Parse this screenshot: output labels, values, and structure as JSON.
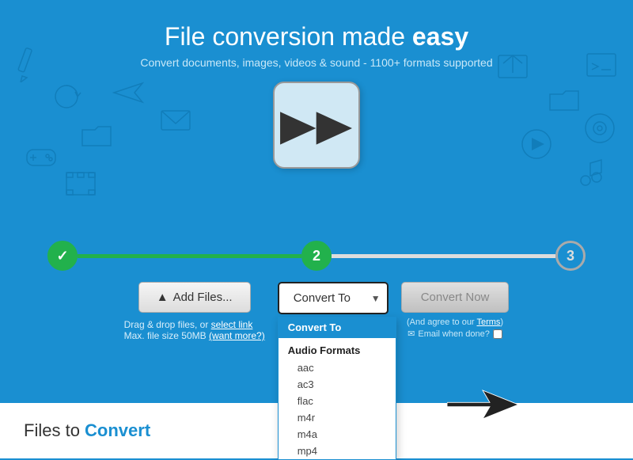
{
  "hero": {
    "title_prefix": "File ",
    "title_main": "conversion made ",
    "title_bold": "easy",
    "subtitle": "Convert documents, images, videos & sound - 1100+ formats supported"
  },
  "steps": {
    "step1": {
      "label": "✓",
      "state": "done"
    },
    "step2": {
      "label": "2",
      "state": "active"
    },
    "step3": {
      "label": "3",
      "state": "inactive"
    }
  },
  "actions": {
    "add_files_label": "Add Files...",
    "drag_text": "Drag & drop files, or",
    "select_link": "select link",
    "max_text": "Max. file size 50MB",
    "want_more_link": "(want more?)",
    "convert_to_label": "Convert To",
    "convert_now_label": "Convert Now",
    "terms_text": "(And agree to our",
    "terms_link": "Terms",
    "email_label": "Email when done?"
  },
  "dropdown": {
    "header": "Convert To",
    "group": "Audio Formats",
    "items": [
      "aac",
      "ac3",
      "flac",
      "m4r",
      "m4a",
      "mp4"
    ]
  },
  "bottom": {
    "files_prefix": "Files",
    "files_middle": " to ",
    "files_bold": "Convert"
  },
  "colors": {
    "brand_blue": "#1a8fd1",
    "green": "#22b14c",
    "white": "#ffffff"
  }
}
